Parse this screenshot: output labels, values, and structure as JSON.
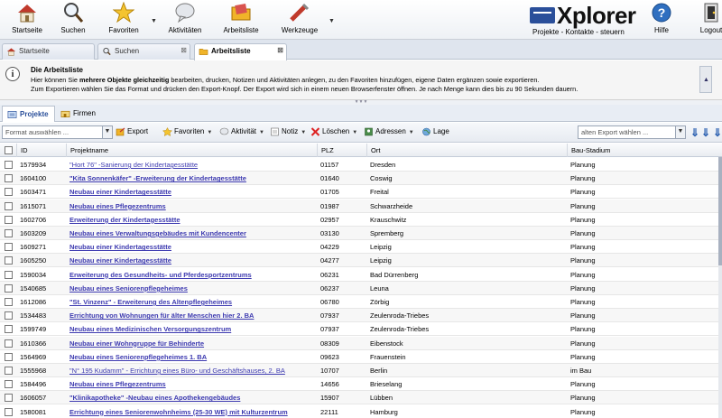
{
  "toolbar": {
    "items": [
      {
        "label": "Startseite",
        "icon": "house-icon"
      },
      {
        "label": "Suchen",
        "icon": "magnifier-icon"
      },
      {
        "label": "Favoriten",
        "icon": "star-icon"
      },
      {
        "label": "Aktivitäten",
        "icon": "speech-bubble-icon"
      },
      {
        "label": "Arbeitsliste",
        "icon": "folder-icon"
      },
      {
        "label": "Werkzeuge",
        "icon": "tools-icon"
      },
      {
        "label": "Hilfe",
        "icon": "help-icon"
      },
      {
        "label": "Logout",
        "icon": "logout-icon"
      }
    ],
    "brand_name": "Xplorer",
    "brand_tagline": "Projekte - Kontakte - steuern"
  },
  "tabs": [
    {
      "label": "Startseite",
      "closable": false
    },
    {
      "label": "Suchen",
      "closable": true
    },
    {
      "label": "Arbeitsliste",
      "closable": true,
      "active": true
    }
  ],
  "info": {
    "title": "Die Arbeitsliste",
    "line1_pre": "Hier können Sie ",
    "line1_bold": "mehrere Objekte gleichzeitig",
    "line1_post": " bearbeiten, drucken, Notizen und Aktivitäten anlegen, zu den Favoriten hinzufügen, eigene Daten ergänzen sowie exportieren.",
    "line2": "Zum Exportieren wählen Sie das Format und drücken den Export-Knopf. Der Export wird sich in einem neuen Browserfenster öffnen. Je nach Menge kann dies bis zu 90 Sekunden dauern."
  },
  "subtabs": [
    {
      "label": "Projekte",
      "active": true
    },
    {
      "label": "Firmen",
      "active": false
    }
  ],
  "actions": {
    "format_placeholder": "Format auswählen ...",
    "export": "Export",
    "favoriten": "Favoriten",
    "aktivitaet": "Aktivität",
    "notiz": "Notiz",
    "loeschen": "Löschen",
    "adressen": "Adressen",
    "lage": "Lage",
    "old_export_placeholder": "alten Export wählen ..."
  },
  "table": {
    "columns": [
      "ID",
      "Projektname",
      "PLZ",
      "Ort",
      "Bau-Stadium"
    ],
    "rows": [
      {
        "id": "1579934",
        "name": "\"Hort 76\" -Sanierung der Kindertagesstätte",
        "bold": false,
        "plz": "01157",
        "ort": "Dresden",
        "stadium": "Planung"
      },
      {
        "id": "1604100",
        "name": "\"Kita Sonnenkäfer\" -Erweiterung der Kindertagesstätte",
        "bold": true,
        "plz": "01640",
        "ort": "Coswig",
        "stadium": "Planung"
      },
      {
        "id": "1603471",
        "name": "Neubau einer Kindertagesstätte",
        "bold": true,
        "plz": "01705",
        "ort": "Freital",
        "stadium": "Planung"
      },
      {
        "id": "1615071",
        "name": "Neubau eines Pflegezentrums",
        "bold": true,
        "plz": "01987",
        "ort": "Schwarzheide",
        "stadium": "Planung"
      },
      {
        "id": "1602706",
        "name": "Erweiterung der Kindertagesstätte",
        "bold": true,
        "plz": "02957",
        "ort": "Krauschwitz",
        "stadium": "Planung"
      },
      {
        "id": "1603209",
        "name": "Neubau eines Verwaltungsgebäudes mit Kundencenter",
        "bold": true,
        "plz": "03130",
        "ort": "Spremberg",
        "stadium": "Planung"
      },
      {
        "id": "1609271",
        "name": "Neubau einer Kindertagesstätte",
        "bold": true,
        "plz": "04229",
        "ort": "Leipzig",
        "stadium": "Planung"
      },
      {
        "id": "1605250",
        "name": "Neubau einer Kindertagesstätte",
        "bold": true,
        "plz": "04277",
        "ort": "Leipzig",
        "stadium": "Planung"
      },
      {
        "id": "1590034",
        "name": "Erweiterung des Gesundheits- und Pferdesportzentrums",
        "bold": true,
        "plz": "06231",
        "ort": "Bad Dürrenberg",
        "stadium": "Planung"
      },
      {
        "id": "1540685",
        "name": "Neubau eines Seniorenpflegeheimes",
        "bold": true,
        "plz": "06237",
        "ort": "Leuna",
        "stadium": "Planung"
      },
      {
        "id": "1612086",
        "name": "\"St. Vinzenz\" - Erweiterung des Altenpflegeheimes",
        "bold": true,
        "plz": "06780",
        "ort": "Zörbig",
        "stadium": "Planung"
      },
      {
        "id": "1534483",
        "name": "Errichtung von Wohnungen für älter Menschen hier 2. BA",
        "bold": true,
        "plz": "07937",
        "ort": "Zeulenroda-Triebes",
        "stadium": "Planung"
      },
      {
        "id": "1599749",
        "name": "Neubau eines Medizinischen Versorgungszentrum",
        "bold": true,
        "plz": "07937",
        "ort": "Zeulenroda-Triebes",
        "stadium": "Planung"
      },
      {
        "id": "1610366",
        "name": "Neubau einer Wohngruppe für Behinderte",
        "bold": true,
        "plz": "08309",
        "ort": "Eibenstock",
        "stadium": "Planung"
      },
      {
        "id": "1564969",
        "name": "Neubau eines Seniorenpflegeheimes 1. BA",
        "bold": true,
        "plz": "09623",
        "ort": "Frauenstein",
        "stadium": "Planung"
      },
      {
        "id": "1555968",
        "name": "\"N° 195 Kudamm\" - Errichtung eines Büro- und Geschäftshauses, 2. BA",
        "bold": false,
        "plz": "10707",
        "ort": "Berlin",
        "stadium": "im Bau"
      },
      {
        "id": "1584496",
        "name": "Neubau eines Pflegezentrums",
        "bold": true,
        "plz": "14656",
        "ort": "Brieselang",
        "stadium": "Planung"
      },
      {
        "id": "1606057",
        "name": "\"Klinikapotheke\" -Neubau eines Apothekengebäudes",
        "bold": true,
        "plz": "15907",
        "ort": "Lübben",
        "stadium": "Planung"
      },
      {
        "id": "1580081",
        "name": "Errichtung eines Seniorenwohnheims (25-30 WE) mit Kulturzentrum",
        "bold": true,
        "plz": "22111",
        "ort": "Hamburg",
        "stadium": "Planung"
      }
    ]
  }
}
